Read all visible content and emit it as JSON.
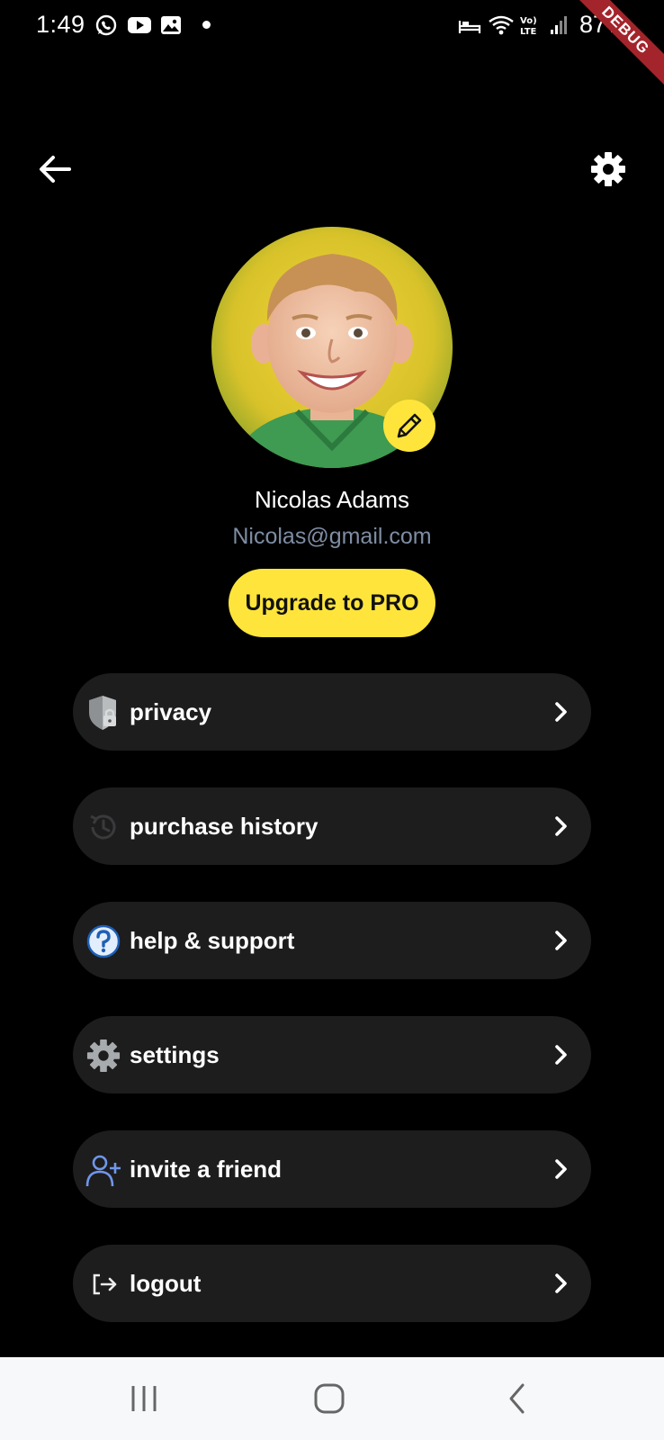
{
  "status_bar": {
    "time": "1:49",
    "battery": "87%",
    "ribbon": "DEBUG",
    "left_icons": [
      "whatsapp-icon",
      "youtube-icon",
      "gallery-icon"
    ],
    "right_icons": [
      "bed-icon",
      "wifi-icon",
      "volte-icon",
      "signal-icon"
    ]
  },
  "header": {
    "back_icon": "arrow-left-icon",
    "settings_icon": "gear-icon"
  },
  "profile": {
    "name": "Nicolas Adams",
    "email": "Nicolas@gmail.com",
    "upgrade_label": "Upgrade to PRO",
    "edit_icon": "pencil-icon"
  },
  "menu": [
    {
      "label": "privacy",
      "icon": "shield-lock-icon"
    },
    {
      "label": "purchase history",
      "icon": "history-icon"
    },
    {
      "label": "help & support",
      "icon": "help-icon"
    },
    {
      "label": "settings",
      "icon": "gear-icon"
    },
    {
      "label": "invite a friend",
      "icon": "add-user-icon"
    },
    {
      "label": "logout",
      "icon": "logout-icon"
    }
  ],
  "colors": {
    "background": "#000000",
    "accent": "#ffe53b",
    "card": "#1d1d1e",
    "email": "#7e8da3",
    "navbar": "#f7f8fa",
    "debug_ribbon": "#a3252b"
  },
  "nav_bar": [
    "recent-apps-icon",
    "home-icon",
    "back-icon"
  ]
}
